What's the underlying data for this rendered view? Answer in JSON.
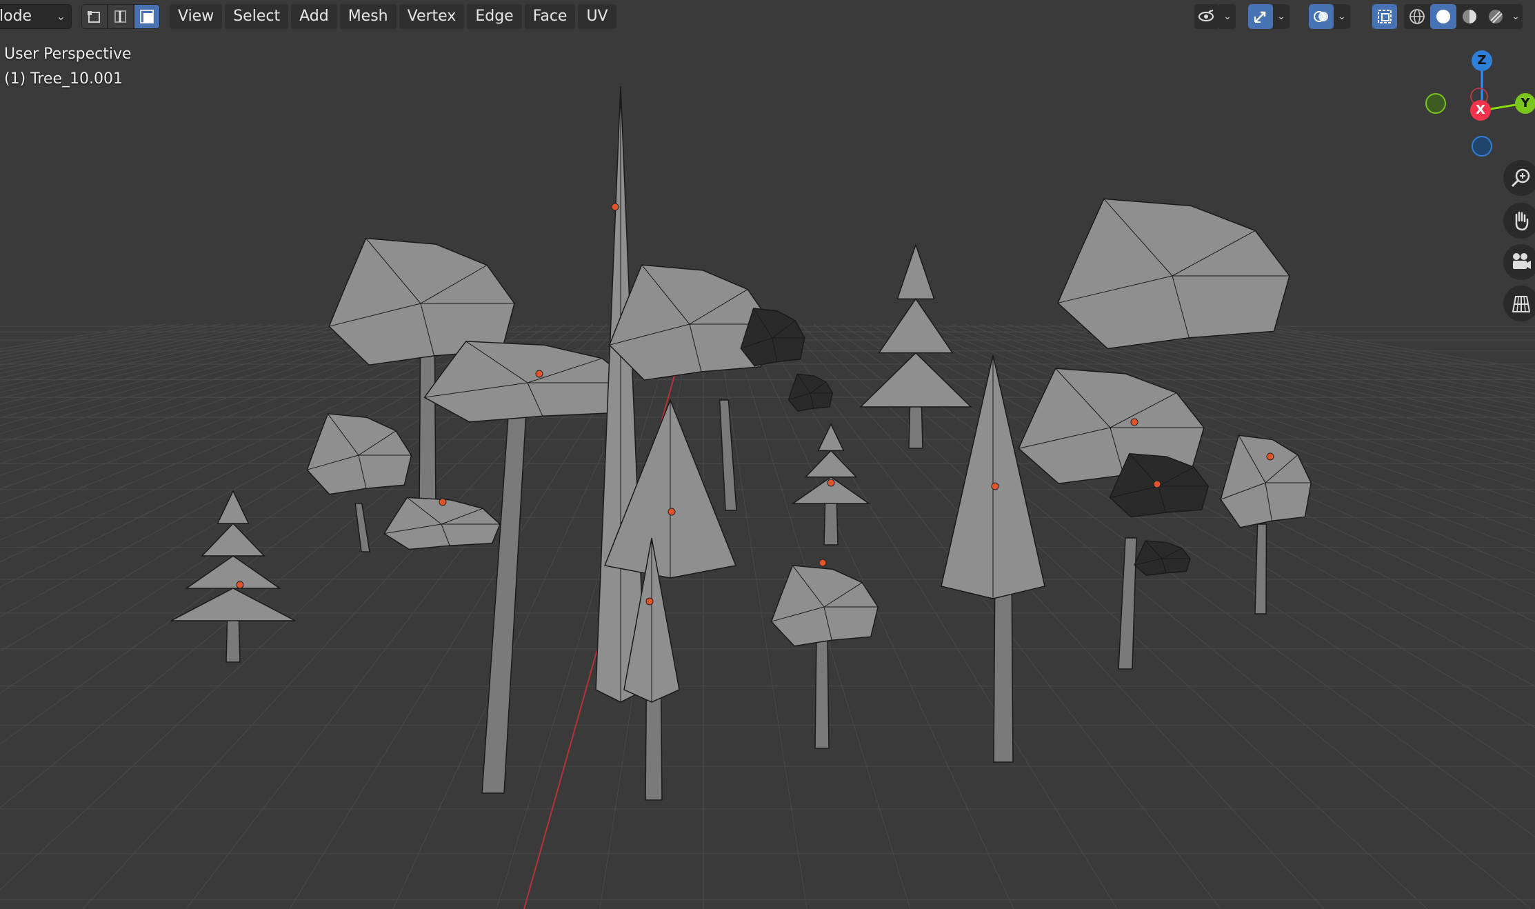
{
  "header": {
    "mode_label": "lode",
    "menu": [
      "View",
      "Select",
      "Add",
      "Mesh",
      "Vertex",
      "Edge",
      "Face",
      "UV"
    ]
  },
  "viewport": {
    "view_name": "User Perspective",
    "object_name": "(1) Tree_10.001"
  },
  "gizmo": {
    "x_label": "X",
    "y_label": "Y",
    "z_label": "Z"
  },
  "icons": {
    "select_modes": [
      "vertex-select-icon",
      "edge-select-icon",
      "face-select-icon"
    ],
    "header_tools": [
      "visibility-icon",
      "gizmo-toggle-icon",
      "overlays-icon",
      "xray-icon",
      "wireframe-shading-icon",
      "solid-shading-icon",
      "material-shading-icon",
      "rendered-shading-icon"
    ],
    "navigation": [
      "zoom-icon",
      "pan-hand-icon",
      "camera-icon",
      "grid-perspective-icon"
    ]
  },
  "colors": {
    "background": "#3a3a3a",
    "accent": "#4772b3",
    "axis_x": "#ff3352",
    "axis_y": "#8bdc00",
    "axis_z": "#2890ff"
  }
}
